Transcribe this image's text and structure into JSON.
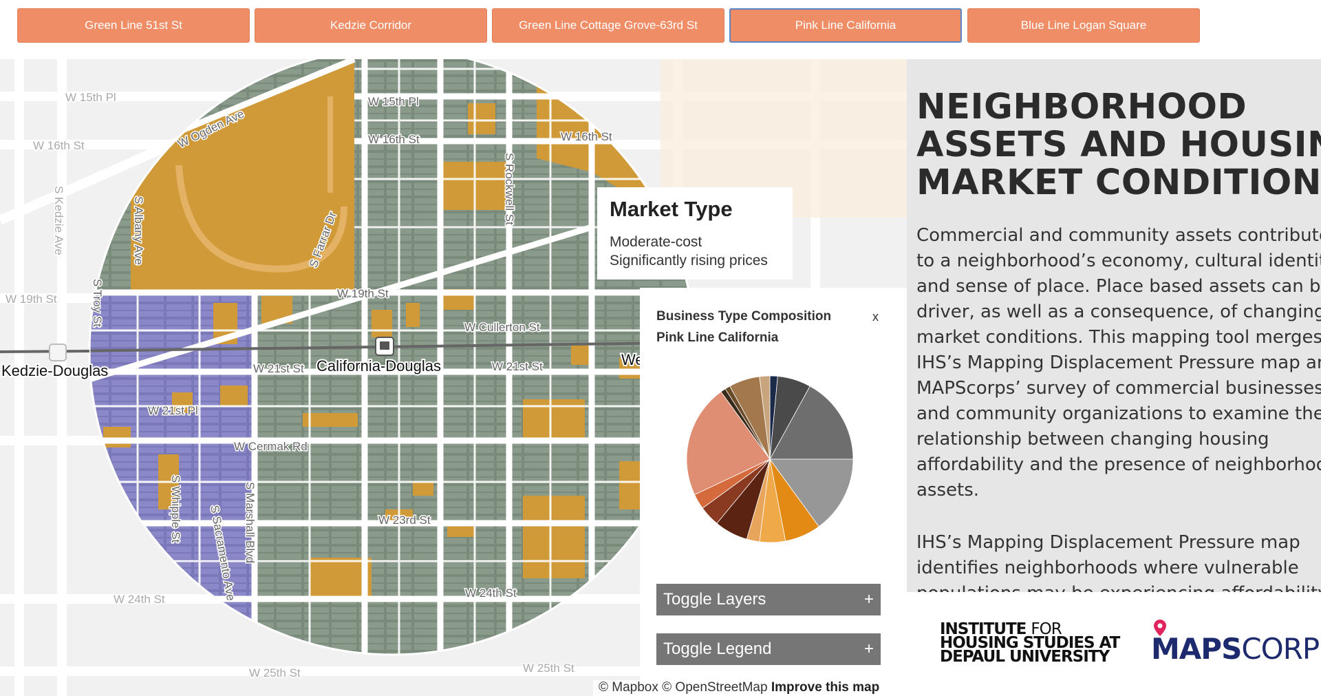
{
  "tabs": [
    {
      "label": "Green Line 51st St",
      "active": false
    },
    {
      "label": "Kedzie Corridor",
      "active": false
    },
    {
      "label": "Green Line Cottage Grove-63rd St",
      "active": false
    },
    {
      "label": "Pink Line California",
      "active": true
    },
    {
      "label": "Blue Line Logan Square",
      "active": false
    }
  ],
  "map": {
    "streets": [
      "W 15th Pl",
      "W 16th St",
      "W Ogden Ave",
      "S Albany Ave",
      "S Farrar Dr",
      "S Rockwell St",
      "W 19th St",
      "W Cullerton St",
      "W 21st St",
      "W 21st Pl",
      "W Cermak Rd",
      "S Troy St",
      "S Whipple St",
      "S Sacramento Ave",
      "S Marshall Blvd",
      "W 23rd St",
      "W 24th St",
      "W 25th St",
      "S Kedzie Ave",
      "W 19th St",
      "W 15th Pl",
      "W 16th St",
      "W 16th St",
      "W 21st St",
      "W 24th St",
      "W 25th St"
    ],
    "stations": [
      "California-Douglas",
      "Kedzie-Douglas",
      "We"
    ],
    "attribution": {
      "mapbox": "© Mapbox",
      "osm": "© OpenStreetMap",
      "improve": "Improve this map"
    }
  },
  "market_popup": {
    "title": "Market Type",
    "lines": [
      "Moderate-cost",
      "Significantly rising prices"
    ]
  },
  "business_panel": {
    "title_line1": "Business Type Composition",
    "title_line2": "Pink Line California",
    "close_label": "x",
    "toggle_layers": "Toggle Layers",
    "toggle_legend": "Toggle Legend",
    "toggle_icon": "+"
  },
  "chart_data": {
    "type": "pie",
    "values": [
      1.5,
      6.5,
      17,
      15,
      7,
      5,
      2.5,
      6.5,
      4,
      3,
      22,
      1,
      1,
      6,
      2
    ],
    "colors": [
      "#1c2a4a",
      "#4a4a4a",
      "#6e6e6e",
      "#979797",
      "#e28a14",
      "#f0a949",
      "#e8a45a",
      "#5b2412",
      "#8b3a22",
      "#d56a3c",
      "#e08e73",
      "#3a2a1a",
      "#6b4a2a",
      "#a3784c",
      "#c9a57e"
    ]
  },
  "text_panel": {
    "heading": [
      "NEIGHBORHOOD",
      "ASSETS AND HOUSING",
      "MARKET CONDITIONS"
    ],
    "para1": [
      "Commercial and community assets contribute",
      "to a neighborhood’s economy, cultural identity,",
      "and sense of place. Place based assets can be a",
      "driver, as well as a consequence, of changing",
      "market conditions. This mapping tool merges",
      "IHS’s Mapping Displacement Pressure map and",
      "MAPScorps’ survey of commercial businesses",
      "and community organizations to examine the",
      "relationship between changing housing",
      "affordability and the presence of neighborhood",
      "assets."
    ],
    "para2": [
      "IHS’s Mapping Displacement Pressure map",
      "identifies neighborhoods where vulnerable",
      "populations may be experiencing affordability"
    ]
  },
  "logos": {
    "ihs": {
      "line1_a": "INSTITUTE",
      "line1_b": "FOR",
      "line2": "HOUSING STUDIES AT",
      "line3": "DEPAUL UNIVERSITY"
    },
    "mapscorps": {
      "maps": "MAPS",
      "corps": "CORPS"
    }
  }
}
